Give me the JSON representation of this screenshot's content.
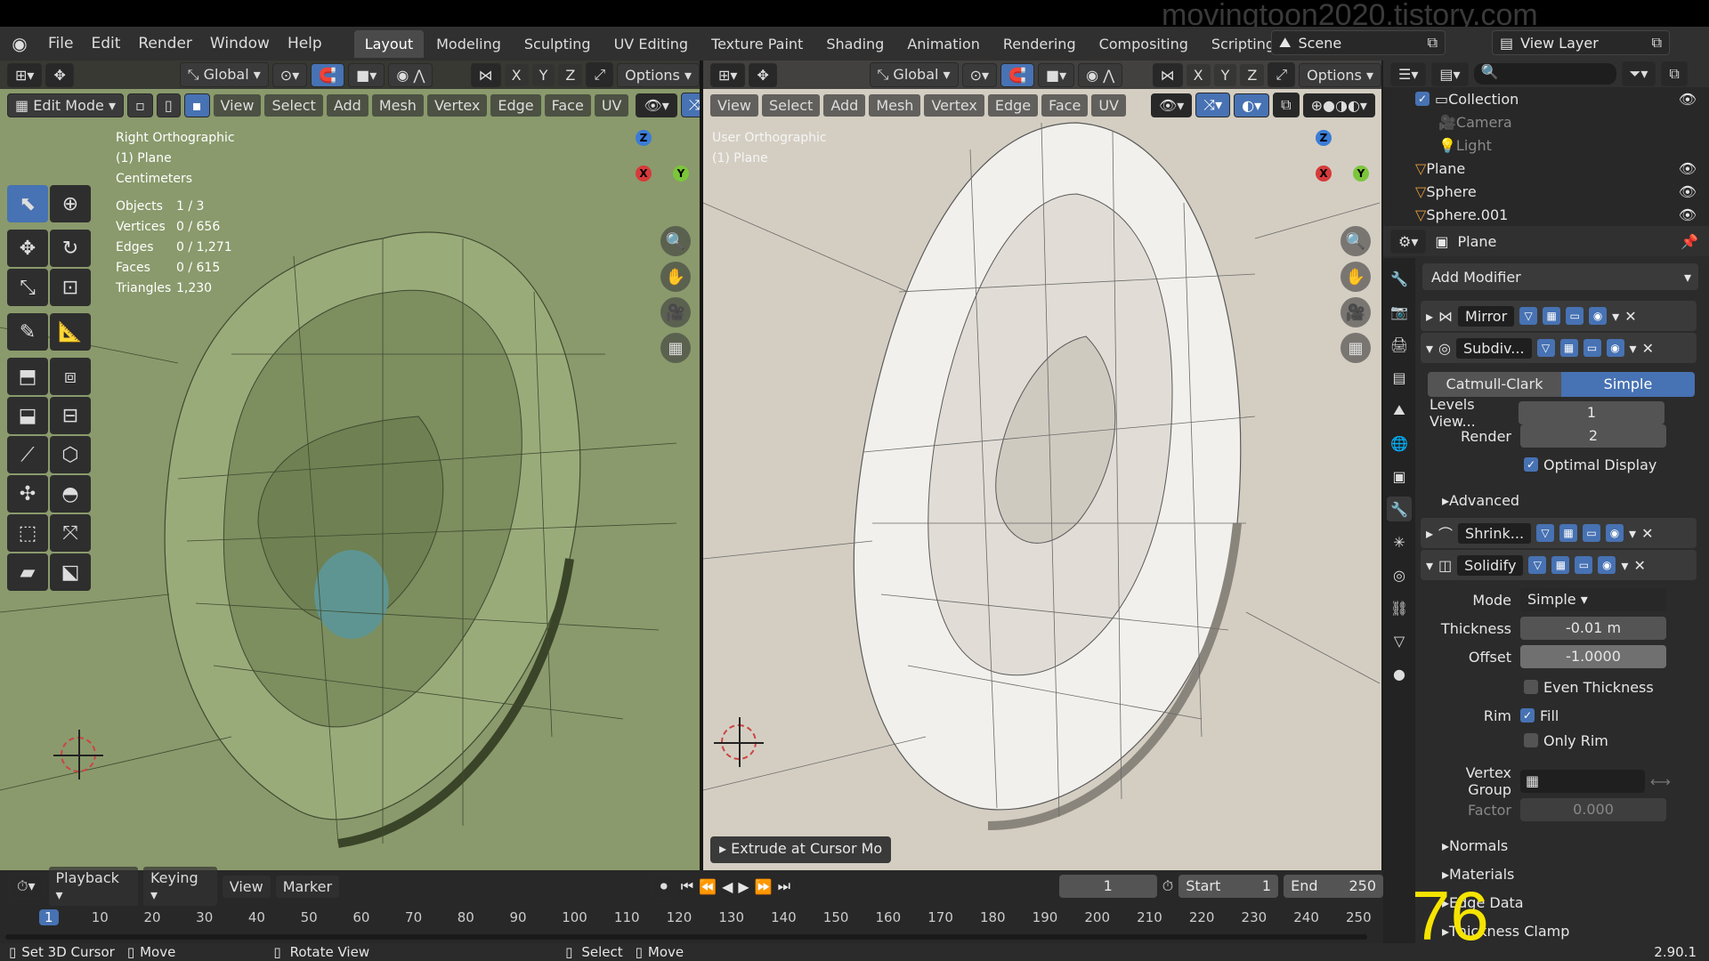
{
  "watermark": "movingtoon2020.tistory.com",
  "menubar": {
    "items": [
      "File",
      "Edit",
      "Render",
      "Window",
      "Help"
    ],
    "workspaces": [
      "Layout",
      "Modeling",
      "Sculpting",
      "UV Editing",
      "Texture Paint",
      "Shading",
      "Animation",
      "Rendering",
      "Compositing",
      "Scripting"
    ],
    "active_workspace": "Layout",
    "add_tab": "+",
    "scene": "Scene",
    "view_layer": "View Layer"
  },
  "left_viewport": {
    "transform": "Global",
    "options": "Options",
    "mode": "Edit Mode",
    "menus": [
      "View",
      "Select",
      "Add",
      "Mesh",
      "Vertex",
      "Edge",
      "Face",
      "UV"
    ],
    "axes": [
      "X",
      "Y",
      "Z"
    ],
    "view_name": "Right Orthographic",
    "object_name": "(1) Plane",
    "units": "Centimeters",
    "stats": [
      {
        "label": "Objects",
        "value": "1 / 3"
      },
      {
        "label": "Vertices",
        "value": "0 / 656"
      },
      {
        "label": "Edges",
        "value": "0 / 1,271"
      },
      {
        "label": "Faces",
        "value": "0 / 615"
      },
      {
        "label": "Triangles",
        "value": "1,230"
      }
    ],
    "bg_color": "#8a9a6c"
  },
  "right_viewport": {
    "transform": "Global",
    "options": "Options",
    "menus": [
      "View",
      "Select",
      "Add",
      "Mesh",
      "Vertex",
      "Edge",
      "Face",
      "UV"
    ],
    "axes": [
      "X",
      "Y",
      "Z"
    ],
    "view_name": "User Orthographic",
    "object_name": "(1) Plane",
    "last_op": "Extrude at Cursor Mo",
    "bg_color": "#d4cec2"
  },
  "gizmo": {
    "x": "X",
    "y": "Y",
    "z": "Z"
  },
  "outliner": {
    "items": [
      {
        "name": "Collection"
      },
      {
        "name": "Camera"
      },
      {
        "name": "Light"
      },
      {
        "name": "Plane"
      },
      {
        "name": "Sphere"
      },
      {
        "name": "Sphere.001"
      }
    ]
  },
  "properties": {
    "object": "Plane",
    "add_modifier": "Add Modifier",
    "modifiers": [
      "Mirror",
      "Subdiv...",
      "Shrink...",
      "Solidify"
    ],
    "subdiv": {
      "mode_a": "Catmull-Clark",
      "mode_b": "Simple",
      "levels_label": "Levels View...",
      "levels_value": "1",
      "render_label": "Render",
      "render_value": "2",
      "optimal": "Optimal Display",
      "advanced": "Advanced"
    },
    "solidify": {
      "mode_label": "Mode",
      "mode_value": "Simple",
      "thickness_label": "Thickness",
      "thickness_value": "-0.01 m",
      "offset_label": "Offset",
      "offset_value": "-1.0000",
      "even": "Even Thickness",
      "rim_label": "Rim",
      "fill": "Fill",
      "only_rim": "Only Rim",
      "vgroup_label": "Vertex Group",
      "factor_label": "Factor",
      "factor_value": "0.000",
      "panels": [
        "Normals",
        "Materials",
        "Edge Data",
        "Thickness Clamp"
      ]
    }
  },
  "timeline": {
    "menus": [
      "Playback",
      "Keying",
      "View",
      "Marker"
    ],
    "current_frame": "1",
    "start_label": "Start",
    "start_value": "1",
    "end_label": "End",
    "end_value": "250",
    "ticks": [
      "1",
      "10",
      "20",
      "30",
      "40",
      "50",
      "60",
      "70",
      "80",
      "90",
      "100",
      "110",
      "120",
      "130",
      "140",
      "150",
      "160",
      "170",
      "180",
      "190",
      "200",
      "210",
      "220",
      "230",
      "240",
      "250"
    ]
  },
  "statusbar": {
    "items": [
      "Set 3D Cursor",
      "Move",
      "Rotate View",
      "Select",
      "Move"
    ],
    "version": "2.90.1"
  },
  "overlay_number": "76"
}
